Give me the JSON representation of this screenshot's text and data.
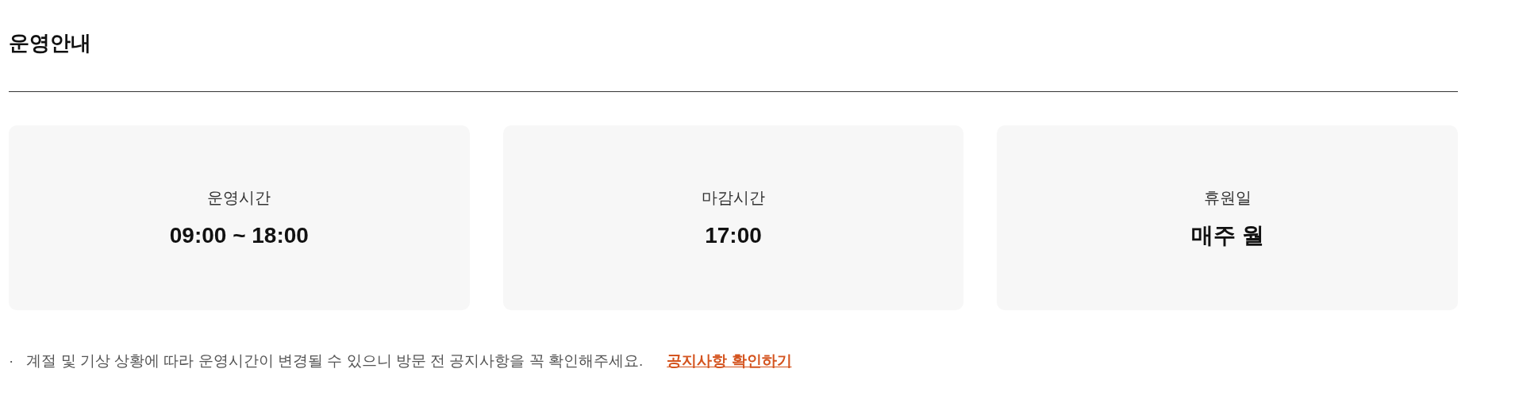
{
  "title": "운영안내",
  "cards": [
    {
      "label": "운영시간",
      "value": "09:00 ~ 18:00"
    },
    {
      "label": "마감시간",
      "value": "17:00"
    },
    {
      "label": "휴원일",
      "value": "매주 월"
    }
  ],
  "notice": {
    "bullet": "·",
    "text": "계절 및 기상 상황에 따라 운영시간이 변경될 수 있으니 방문 전 공지사항을 꼭 확인해주세요.",
    "link": "공지사항 확인하기"
  }
}
